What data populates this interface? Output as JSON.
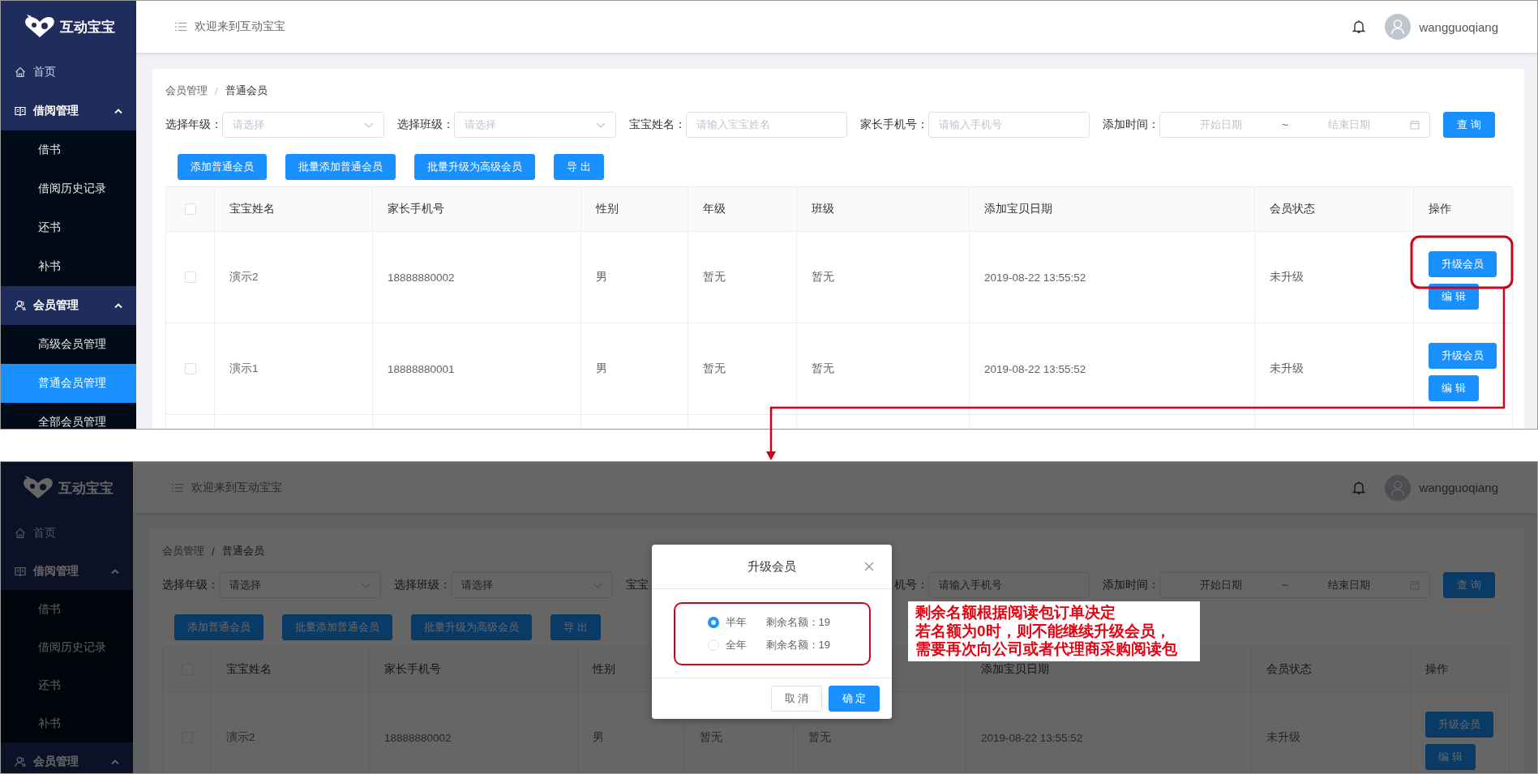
{
  "screens": [
    {
      "dimmed": false,
      "logo": "互动宝宝",
      "sidebar": {
        "items": [
          {
            "label": "首页"
          },
          {
            "label": "借阅管理",
            "expanded": true,
            "children": [
              {
                "label": "借书",
                "selected": false
              },
              {
                "label": "借阅历史记录",
                "selected": false
              },
              {
                "label": "还书",
                "selected": false
              },
              {
                "label": "补书",
                "selected": false
              }
            ]
          },
          {
            "label": "会员管理",
            "expanded": true,
            "children": [
              {
                "label": "高级会员管理",
                "selected": false
              },
              {
                "label": "普通会员管理",
                "selected": true
              },
              {
                "label": "全部会员管理",
                "selected": false
              }
            ]
          }
        ]
      },
      "header": {
        "welcome": "欢迎来到互动宝宝",
        "user": "wangguoqiang"
      },
      "breadcrumb": {
        "items": [
          "会员管理",
          "普通会员"
        ],
        "separator": "/"
      },
      "filters": [
        {
          "kind": "select",
          "label": "选择年级：",
          "placeholder": "请选择"
        },
        {
          "kind": "select",
          "label": "选择班级：",
          "placeholder": "请选择"
        },
        {
          "kind": "input",
          "label": "宝宝姓名：",
          "placeholder": "请输入宝宝姓名"
        },
        {
          "kind": "input",
          "label": "家长手机号：",
          "placeholder": "请输入手机号"
        },
        {
          "kind": "date_range",
          "label": "添加时间：",
          "start_placeholder": "开始日期",
          "separator": "~",
          "end_placeholder": "结束日期"
        }
      ],
      "query_button": "查 询",
      "actions": [
        "添加普通会员",
        "批量添加普通会员",
        "批量升级为高级会员",
        "导 出"
      ],
      "table": {
        "select_all": {
          "checked": false
        },
        "columns": [
          "宝宝姓名",
          "家长手机号",
          "性别",
          "年级",
          "班级",
          "添加宝贝日期",
          "会员状态",
          "操作"
        ],
        "rows": [
          {
            "checked": false,
            "cells": [
              "演示2",
              "18888880002",
              "男",
              "暂无",
              "暂无",
              "2019-08-22 13:55:52",
              "未升级"
            ],
            "buttons": [
              "升级会员",
              "编 辑"
            ]
          },
          {
            "checked": false,
            "cells": [
              "演示1",
              "18888880001",
              "男",
              "暂无",
              "暂无",
              "2019-08-22 13:55:52",
              "未升级"
            ],
            "buttons": [
              "升级会员",
              "编 辑"
            ]
          }
        ]
      }
    },
    {
      "dimmed": true,
      "logo": "互动宝宝",
      "sidebar": {
        "items": [
          {
            "label": "首页"
          },
          {
            "label": "借阅管理",
            "expanded": true,
            "children": [
              {
                "label": "借书",
                "selected": false
              },
              {
                "label": "借阅历史记录",
                "selected": false
              },
              {
                "label": "还书",
                "selected": false
              },
              {
                "label": "补书",
                "selected": false
              }
            ]
          },
          {
            "label": "会员管理",
            "expanded": true
          }
        ]
      },
      "header": {
        "welcome": "欢迎来到互动宝宝",
        "user": "wangguoqiang"
      },
      "breadcrumb": {
        "items": [
          "会员管理",
          "普通会员"
        ],
        "separator": "/"
      },
      "filters": [
        {
          "kind": "select",
          "label": "选择年级：",
          "placeholder": "请选择"
        },
        {
          "kind": "select",
          "label": "选择班级：",
          "placeholder": "请选择"
        },
        {
          "kind": "label",
          "label": "宝宝"
        },
        {
          "kind": "input",
          "label": "机号：",
          "placeholder": "请输入手机号"
        },
        {
          "kind": "date_range",
          "label": "添加时间：",
          "start_placeholder": "开始日期",
          "separator": "~",
          "end_placeholder": "结束日期"
        }
      ],
      "query_button": "查 询",
      "actions": [
        "添加普通会员",
        "批量添加普通会员",
        "批量升级为高级会员",
        "导 出"
      ],
      "table": {
        "select_all": {
          "checked": false
        },
        "columns": [
          "宝宝姓名",
          "家长手机号",
          "性别",
          null,
          null,
          "添加宝贝日期",
          "会员状态",
          "操作"
        ],
        "rows": [
          {
            "checked": false,
            "cells": [
              "演示2",
              "18888880002",
              "男",
              "暂无",
              "暂无",
              "2019-08-22 13:55:52",
              "未升级"
            ],
            "buttons": [
              "升级会员",
              "编 辑"
            ]
          }
        ]
      },
      "modal": {
        "title": "升级会员",
        "options": [
          {
            "label": "半年",
            "selected": true,
            "quota": "剩余名额：19"
          },
          {
            "label": "全年",
            "selected": false,
            "quota": "剩余名额：19"
          }
        ],
        "buttons": [
          {
            "label": "取 消",
            "kind": "default"
          },
          {
            "label": "确 定",
            "kind": "primary"
          }
        ]
      },
      "note": {
        "lines": [
          "剩余名额根据阅读包订单决定",
          "若名额为0时，则不能继续升级会员，",
          "需要再次向公司或者代理商采购阅读包"
        ]
      }
    }
  ]
}
